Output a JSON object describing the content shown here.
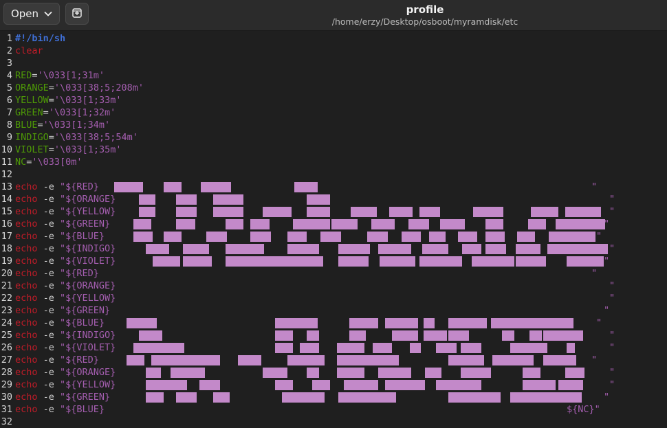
{
  "header": {
    "open_label": "Open",
    "title": "profile",
    "subtitle": "/home/erzy/Desktop/osboot/myramdisk/etc"
  },
  "colors": {
    "background": "#1f1f1f",
    "header": "#2b2b2b",
    "keyword": "#c01c28",
    "variable": "#4e9a06",
    "string": "#a55eb0",
    "shebang": "#3f6fd6",
    "block": "#c389c9"
  },
  "icons": {
    "open_dropdown": "chevron-down-icon",
    "new_tab": "new-tab-icon"
  },
  "lines": [
    {
      "n": "1",
      "tokens": [
        {
          "t": "#!/bin/sh",
          "c": "comment"
        }
      ]
    },
    {
      "n": "2",
      "tokens": [
        {
          "t": "clear",
          "c": "cmd"
        }
      ]
    },
    {
      "n": "3",
      "tokens": []
    },
    {
      "n": "4",
      "tokens": [
        {
          "t": "RED",
          "c": "var"
        },
        {
          "t": "=",
          "c": "op"
        },
        {
          "t": "'\\033[1;31m'",
          "c": "str"
        }
      ]
    },
    {
      "n": "5",
      "tokens": [
        {
          "t": "ORANGE",
          "c": "var"
        },
        {
          "t": "=",
          "c": "op"
        },
        {
          "t": "'\\033[38;5;208m'",
          "c": "str"
        }
      ]
    },
    {
      "n": "6",
      "tokens": [
        {
          "t": "YELLOW",
          "c": "var"
        },
        {
          "t": "=",
          "c": "op"
        },
        {
          "t": "'\\033[1;33m'",
          "c": "str"
        }
      ]
    },
    {
      "n": "7",
      "tokens": [
        {
          "t": "GREEN",
          "c": "var"
        },
        {
          "t": "=",
          "c": "op"
        },
        {
          "t": "'\\033[1;32m'",
          "c": "str"
        }
      ]
    },
    {
      "n": "8",
      "tokens": [
        {
          "t": "BLUE",
          "c": "var"
        },
        {
          "t": "=",
          "c": "op"
        },
        {
          "t": "'\\033[1;34m'",
          "c": "str"
        }
      ]
    },
    {
      "n": "9",
      "tokens": [
        {
          "t": "INDIGO",
          "c": "var"
        },
        {
          "t": "=",
          "c": "op"
        },
        {
          "t": "'\\033[38;5;54m'",
          "c": "str"
        }
      ]
    },
    {
      "n": "10",
      "tokens": [
        {
          "t": "VIOLET",
          "c": "var"
        },
        {
          "t": "=",
          "c": "op"
        },
        {
          "t": "'\\033[1;35m'",
          "c": "str"
        }
      ]
    },
    {
      "n": "11",
      "tokens": [
        {
          "t": "NC",
          "c": "var"
        },
        {
          "t": "=",
          "c": "op"
        },
        {
          "t": "'\\033[0m'",
          "c": "str"
        }
      ]
    },
    {
      "n": "12",
      "tokens": []
    },
    {
      "n": "13",
      "tokens": [
        {
          "t": "echo",
          "c": "cmd"
        },
        {
          "t": " -e ",
          "c": "op"
        },
        {
          "t": "\"${RED}",
          "c": "str"
        }
      ],
      "end": "\""
    },
    {
      "n": "14",
      "tokens": [
        {
          "t": "echo",
          "c": "cmd"
        },
        {
          "t": " -e ",
          "c": "op"
        },
        {
          "t": "\"${ORANGE}",
          "c": "str"
        }
      ],
      "end": "\""
    },
    {
      "n": "15",
      "tokens": [
        {
          "t": "echo",
          "c": "cmd"
        },
        {
          "t": " -e ",
          "c": "op"
        },
        {
          "t": "\"${YELLOW}",
          "c": "str"
        }
      ],
      "end": "\""
    },
    {
      "n": "16",
      "tokens": [
        {
          "t": "echo",
          "c": "cmd"
        },
        {
          "t": " -e ",
          "c": "op"
        },
        {
          "t": "\"${GREEN}",
          "c": "str"
        }
      ],
      "end": "\""
    },
    {
      "n": "17",
      "tokens": [
        {
          "t": "echo",
          "c": "cmd"
        },
        {
          "t": " -e ",
          "c": "op"
        },
        {
          "t": "\"${BLUE}",
          "c": "str"
        }
      ],
      "end": "\""
    },
    {
      "n": "18",
      "tokens": [
        {
          "t": "echo",
          "c": "cmd"
        },
        {
          "t": " -e ",
          "c": "op"
        },
        {
          "t": "\"${INDIGO}",
          "c": "str"
        }
      ],
      "end": "\""
    },
    {
      "n": "19",
      "tokens": [
        {
          "t": "echo",
          "c": "cmd"
        },
        {
          "t": " -e ",
          "c": "op"
        },
        {
          "t": "\"${VIOLET}",
          "c": "str"
        }
      ],
      "end": "\""
    },
    {
      "n": "20",
      "tokens": [
        {
          "t": "echo",
          "c": "cmd"
        },
        {
          "t": " -e ",
          "c": "op"
        },
        {
          "t": "\"${RED}",
          "c": "str"
        }
      ],
      "end": "\""
    },
    {
      "n": "21",
      "tokens": [
        {
          "t": "echo",
          "c": "cmd"
        },
        {
          "t": " -e ",
          "c": "op"
        },
        {
          "t": "\"${ORANGE}",
          "c": "str"
        }
      ],
      "end": "\""
    },
    {
      "n": "22",
      "tokens": [
        {
          "t": "echo",
          "c": "cmd"
        },
        {
          "t": " -e ",
          "c": "op"
        },
        {
          "t": "\"${YELLOW}",
          "c": "str"
        }
      ],
      "end": "\""
    },
    {
      "n": "23",
      "tokens": [
        {
          "t": "echo",
          "c": "cmd"
        },
        {
          "t": " -e ",
          "c": "op"
        },
        {
          "t": "\"${GREEN}",
          "c": "str"
        }
      ],
      "end": "\""
    },
    {
      "n": "24",
      "tokens": [
        {
          "t": "echo",
          "c": "cmd"
        },
        {
          "t": " -e ",
          "c": "op"
        },
        {
          "t": "\"${BLUE}",
          "c": "str"
        }
      ],
      "end": "\""
    },
    {
      "n": "25",
      "tokens": [
        {
          "t": "echo",
          "c": "cmd"
        },
        {
          "t": " -e ",
          "c": "op"
        },
        {
          "t": "\"${INDIGO}",
          "c": "str"
        }
      ],
      "end": "\""
    },
    {
      "n": "26",
      "tokens": [
        {
          "t": "echo",
          "c": "cmd"
        },
        {
          "t": " -e ",
          "c": "op"
        },
        {
          "t": "\"${VIOLET}",
          "c": "str"
        }
      ],
      "end": "\""
    },
    {
      "n": "27",
      "tokens": [
        {
          "t": "echo",
          "c": "cmd"
        },
        {
          "t": " -e ",
          "c": "op"
        },
        {
          "t": "\"${RED}",
          "c": "str"
        }
      ],
      "end": "\""
    },
    {
      "n": "28",
      "tokens": [
        {
          "t": "echo",
          "c": "cmd"
        },
        {
          "t": " -e ",
          "c": "op"
        },
        {
          "t": "\"${ORANGE}",
          "c": "str"
        }
      ],
      "end": "\""
    },
    {
      "n": "29",
      "tokens": [
        {
          "t": "echo",
          "c": "cmd"
        },
        {
          "t": " -e ",
          "c": "op"
        },
        {
          "t": "\"${YELLOW}",
          "c": "str"
        }
      ],
      "end": "\""
    },
    {
      "n": "30",
      "tokens": [
        {
          "t": "echo",
          "c": "cmd"
        },
        {
          "t": " -e ",
          "c": "op"
        },
        {
          "t": "\"${GREEN}",
          "c": "str"
        }
      ],
      "end": "\""
    },
    {
      "n": "31",
      "tokens": [
        {
          "t": "echo",
          "c": "cmd"
        },
        {
          "t": " -e ",
          "c": "op"
        },
        {
          "t": "\"${BLUE}",
          "c": "str"
        }
      ],
      "end": "${NC}\""
    },
    {
      "n": "32",
      "tokens": []
    }
  ]
}
